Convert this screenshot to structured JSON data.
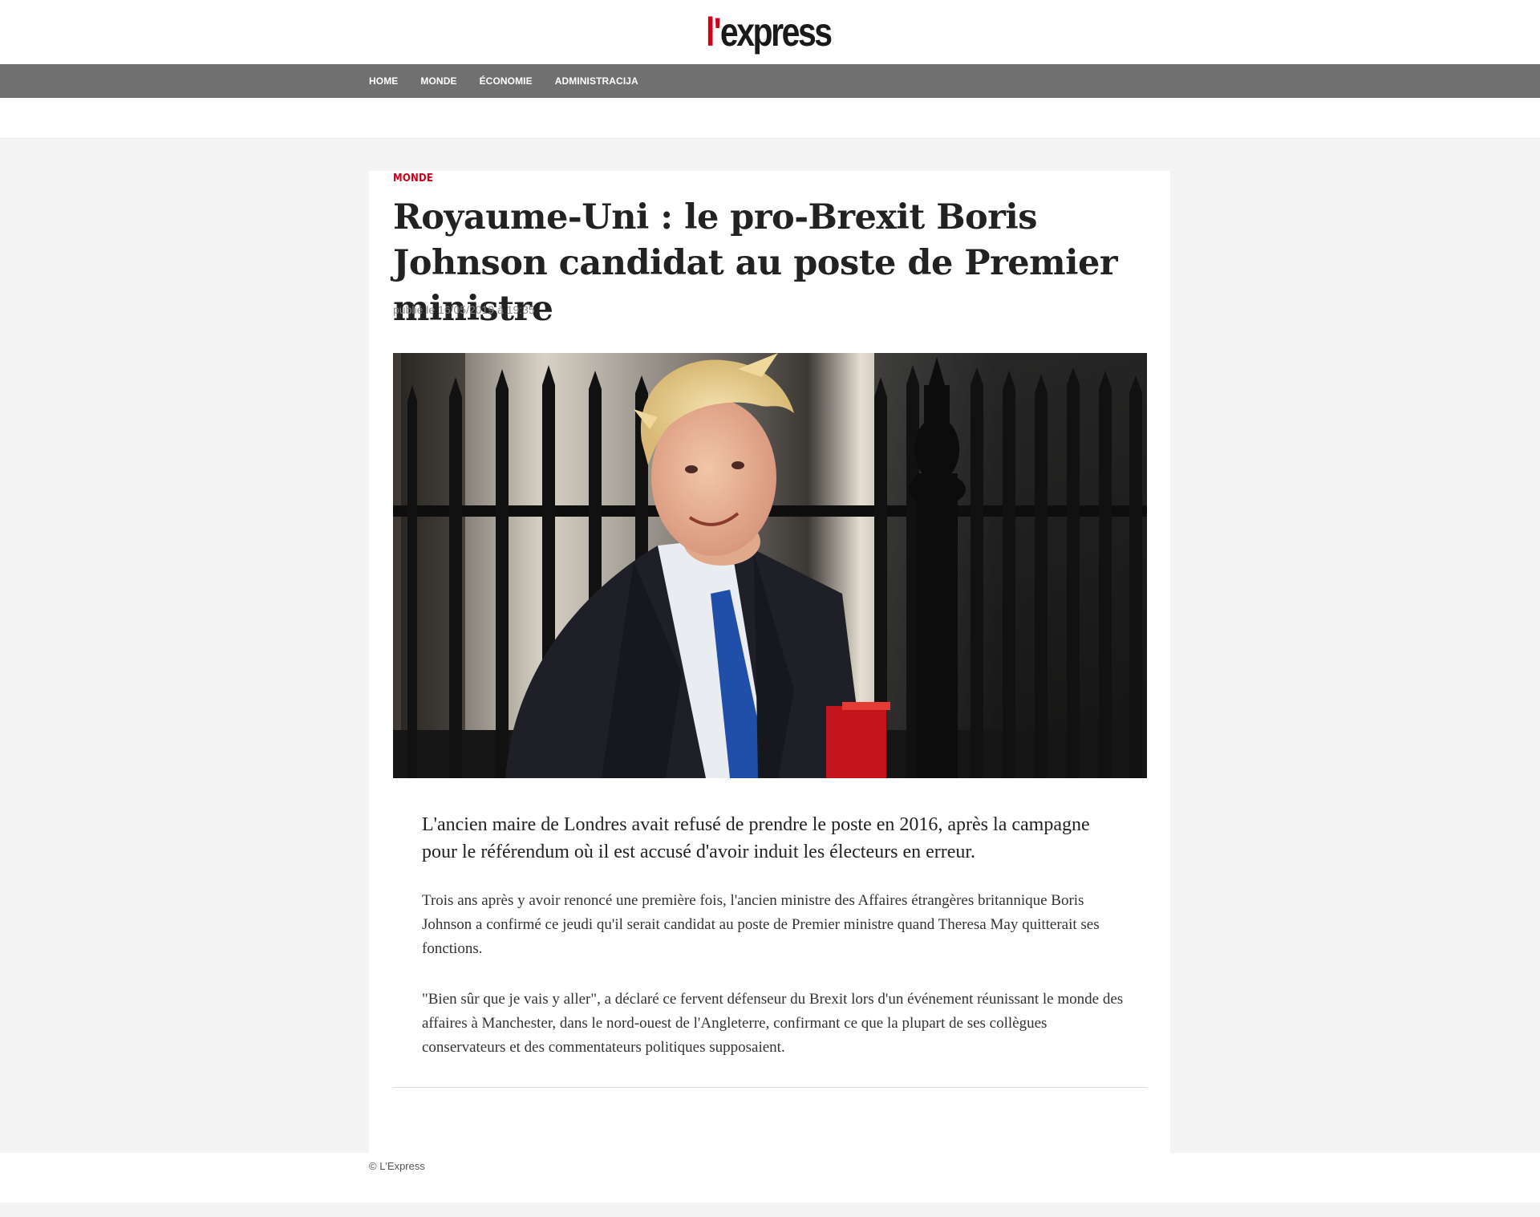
{
  "site": {
    "logo_prefix": "l'",
    "logo_name": "express"
  },
  "nav": {
    "items": [
      {
        "label": "Home"
      },
      {
        "label": "Monde"
      },
      {
        "label": "Économie"
      },
      {
        "label": "Administracija"
      }
    ]
  },
  "article": {
    "category": "Monde",
    "headline": "Royaume-Uni : le pro-Brexit Boris Johnson candidat au poste de Premier ministre",
    "published": "publié le 16/05/2019 à 19:35",
    "lede": "L'ancien maire de Londres avait refusé de prendre le poste en 2016, après la campagne pour le référendum où il est accusé d'avoir induit les électeurs en erreur.",
    "paragraphs": [
      "Trois ans après y avoir renoncé une première fois, l'ancien ministre des Affaires étrangères britannique Boris Johnson a confirmé ce jeudi qu'il serait candidat au poste de Premier ministre quand Theresa May quitterait ses fonctions.",
      "\"Bien sûr que je vais y aller\", a déclaré ce fervent défenseur du Brexit lors d'un événement réunissant le monde des affaires à Manchester, dans le nord-ouest de l'Angleterre, confirmant ce que la plupart de ses collègues conservateurs et des commentateurs politiques supposaient."
    ]
  },
  "footer": {
    "copyright": "© L'Express"
  },
  "colors": {
    "brand_red": "#d0021b",
    "nav_bg": "#707070",
    "page_bg": "#f4f4f4"
  }
}
